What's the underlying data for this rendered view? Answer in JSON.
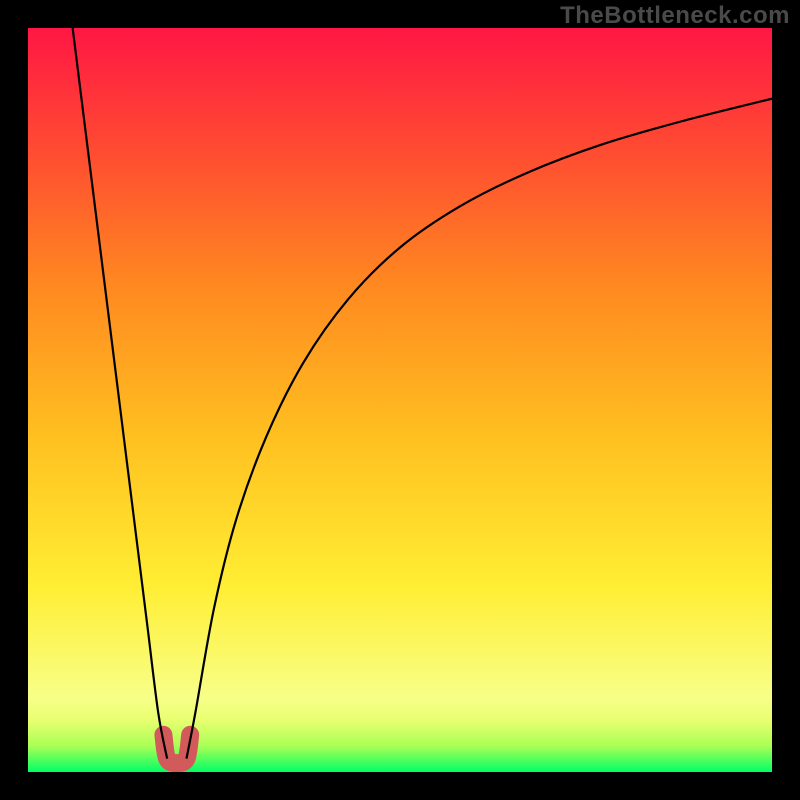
{
  "watermark": "TheBottleneck.com",
  "chart_data": {
    "type": "line",
    "title": "",
    "xlabel": "",
    "ylabel": "",
    "xlim": [
      0,
      100
    ],
    "ylim": [
      0,
      100
    ],
    "grid": false,
    "legend": false,
    "background": {
      "type": "vertical-gradient",
      "stops": [
        {
          "pos": 0.0,
          "color": "#00ff66"
        },
        {
          "pos": 0.035,
          "color": "#aaff55"
        },
        {
          "pos": 0.07,
          "color": "#e8ff70"
        },
        {
          "pos": 0.1,
          "color": "#f8ff88"
        },
        {
          "pos": 0.25,
          "color": "#ffee33"
        },
        {
          "pos": 0.45,
          "color": "#ffc020"
        },
        {
          "pos": 0.65,
          "color": "#ff8a20"
        },
        {
          "pos": 0.82,
          "color": "#ff5030"
        },
        {
          "pos": 1.0,
          "color": "#ff1744"
        }
      ]
    },
    "series": [
      {
        "name": "left-branch",
        "x": [
          6.0,
          8.0,
          10.0,
          12.0,
          14.0,
          16.0,
          17.5,
          18.7
        ],
        "y": [
          100.0,
          84.0,
          68.0,
          52.0,
          36.0,
          20.0,
          8.0,
          1.8
        ]
      },
      {
        "name": "right-branch",
        "x": [
          21.3,
          22.5,
          25.0,
          28.0,
          32.0,
          37.0,
          43.0,
          50.0,
          58.0,
          67.0,
          77.0,
          88.0,
          100.0
        ],
        "y": [
          1.8,
          8.0,
          22.0,
          34.0,
          45.0,
          55.0,
          63.5,
          70.5,
          76.0,
          80.5,
          84.3,
          87.5,
          90.5
        ]
      }
    ],
    "markers": [
      {
        "name": "dip-u-marker",
        "type": "u-shape",
        "color": "#d25a5a",
        "points": [
          {
            "x": 18.2,
            "y": 5.0
          },
          {
            "x": 18.7,
            "y": 1.8
          },
          {
            "x": 20.0,
            "y": 1.2
          },
          {
            "x": 21.3,
            "y": 1.8
          },
          {
            "x": 21.8,
            "y": 5.0
          }
        ]
      }
    ]
  }
}
